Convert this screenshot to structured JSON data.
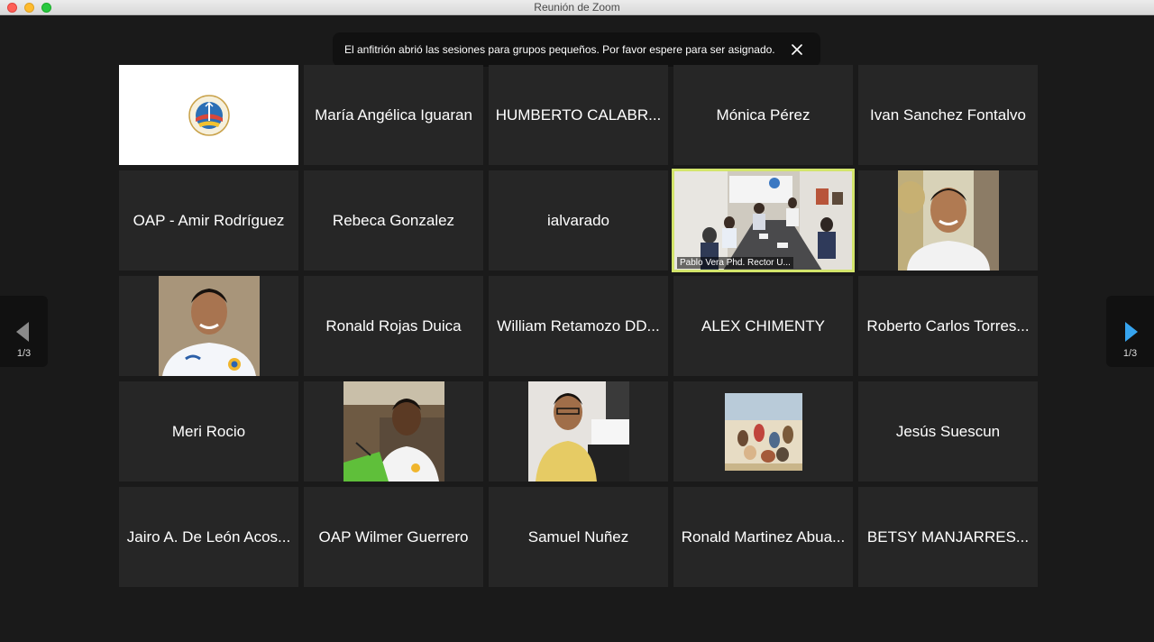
{
  "window": {
    "title": "Reunión de Zoom"
  },
  "notification": {
    "text": "El anfitrión abrió las sesiones para grupos pequeños. Por favor espere para ser asignado.",
    "close_icon": "close-icon"
  },
  "pager": {
    "left_label": "1/3",
    "right_label": "1/3"
  },
  "tiles": [
    {
      "kind": "logo",
      "name": ""
    },
    {
      "kind": "name",
      "name": "María Angélica Iguaran"
    },
    {
      "kind": "name",
      "name": "HUMBERTO CALABR..."
    },
    {
      "kind": "name",
      "name": "Mónica Pérez"
    },
    {
      "kind": "name",
      "name": "Ivan Sanchez Fontalvo"
    },
    {
      "kind": "name",
      "name": "OAP - Amir Rodríguez"
    },
    {
      "kind": "name",
      "name": "Rebeca Gonzalez"
    },
    {
      "kind": "name",
      "name": "ialvarado"
    },
    {
      "kind": "video",
      "name": "Pablo Vera Phd. Rector U..."
    },
    {
      "kind": "photo",
      "name": ""
    },
    {
      "kind": "photo",
      "name": ""
    },
    {
      "kind": "name",
      "name": "Ronald Rojas Duica"
    },
    {
      "kind": "name",
      "name": "William Retamozo DD..."
    },
    {
      "kind": "name",
      "name": "ALEX CHIMENTY"
    },
    {
      "kind": "name",
      "name": "Roberto Carlos Torres..."
    },
    {
      "kind": "name",
      "name": "Meri Rocio"
    },
    {
      "kind": "photo",
      "name": ""
    },
    {
      "kind": "photo",
      "name": ""
    },
    {
      "kind": "painting",
      "name": ""
    },
    {
      "kind": "name",
      "name": "Jesús Suescun"
    },
    {
      "kind": "name",
      "name": "Jairo A. De León Acos..."
    },
    {
      "kind": "name",
      "name": "OAP Wilmer Guerrero"
    },
    {
      "kind": "name",
      "name": "Samuel Nuñez"
    },
    {
      "kind": "name",
      "name": "Ronald Martinez Abua..."
    },
    {
      "kind": "name",
      "name": "BETSY MANJARRES..."
    }
  ],
  "colors": {
    "speaking_border": "#d3e56b",
    "next_arrow": "#36a4ef"
  }
}
